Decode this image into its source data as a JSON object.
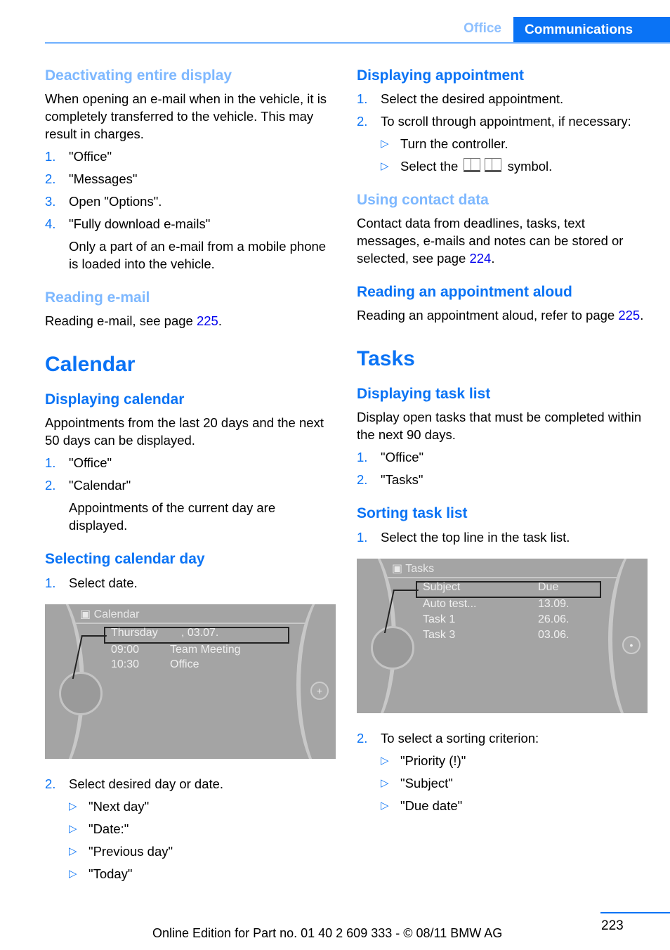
{
  "header": {
    "section": "Office",
    "chapter": "Communications"
  },
  "left": {
    "deactivating": {
      "heading": "Deactivating entire display",
      "text": "When opening an e-mail when in the vehicle, it is completely transferred to the vehicle. This may result in charges.",
      "steps": [
        {
          "num": "1.",
          "text": "\"Office\""
        },
        {
          "num": "2.",
          "text": "\"Messages\""
        },
        {
          "num": "3.",
          "text": "Open \"Options\"."
        },
        {
          "num": "4.",
          "text": "\"Fully download e-mails\""
        }
      ],
      "note": "Only a part of an e-mail from a mobile phone is loaded into the vehicle."
    },
    "reading_email": {
      "heading": "Reading e-mail",
      "text": "Reading e-mail, see page ",
      "page": "225",
      "end": "."
    },
    "calendar": {
      "title": "Calendar",
      "displaying": {
        "heading": "Displaying calendar",
        "text": "Appointments from the last 20 days and the next 50 days can be displayed.",
        "steps": [
          {
            "num": "1.",
            "text": "\"Office\""
          },
          {
            "num": "2.",
            "text": "\"Calendar\""
          }
        ],
        "note": "Appointments of the current day are displayed."
      },
      "selecting": {
        "heading": "Selecting calendar day",
        "step1": {
          "num": "1.",
          "text": "Select date."
        },
        "screen": {
          "title": "Calendar",
          "selected": {
            "day": "Thursday",
            "date": ", 03.07."
          },
          "rows": [
            {
              "time": "09:00",
              "label": "Team Meeting"
            },
            {
              "time": "10:30",
              "label": "Office"
            }
          ]
        },
        "step2": {
          "num": "2.",
          "text": "Select desired day or date."
        },
        "options": [
          "\"Next day\"",
          "\"Date:\"",
          "\"Previous day\"",
          "\"Today\""
        ]
      }
    }
  },
  "right": {
    "displaying_appointment": {
      "heading": "Displaying appointment",
      "steps": [
        {
          "num": "1.",
          "text": "Select the desired appointment."
        },
        {
          "num": "2.",
          "text": "To scroll through appointment, if necessary:"
        }
      ],
      "bullets": [
        "Turn the controller."
      ],
      "symbol_prefix": "Select the",
      "symbol_suffix": "symbol."
    },
    "contact_data": {
      "heading": "Using contact data",
      "text": "Contact data from deadlines, tasks, text messages, e-mails and notes can be stored or selected, see page ",
      "page": "224",
      "end": "."
    },
    "reading_aloud": {
      "heading": "Reading an appointment aloud",
      "text": "Reading an appointment aloud, refer to page ",
      "page": "225",
      "end": "."
    },
    "tasks": {
      "title": "Tasks",
      "displaying": {
        "heading": "Displaying task list",
        "text": "Display open tasks that must be completed within the next 90 days.",
        "steps": [
          {
            "num": "1.",
            "text": "\"Office\""
          },
          {
            "num": "2.",
            "text": "\"Tasks\""
          }
        ]
      },
      "sorting": {
        "heading": "Sorting task list",
        "step1": {
          "num": "1.",
          "text": "Select the top line in the task list."
        },
        "screen": {
          "title": "Tasks",
          "columns": [
            "Subject",
            "Due"
          ],
          "rows": [
            {
              "subject": "Auto test...",
              "due": "13.09."
            },
            {
              "subject": "Task 1",
              "due": "26.06."
            },
            {
              "subject": "Task 3",
              "due": "03.06."
            }
          ]
        },
        "step2": {
          "num": "2.",
          "text": "To select a sorting criterion:"
        },
        "options": [
          "\"Priority (!)\"",
          "\"Subject\"",
          "\"Due date\""
        ]
      }
    }
  },
  "footer": {
    "edition": "Online Edition for Part no. 01 40 2 609 333 - © 08/11 BMW AG",
    "page_number": "223"
  }
}
